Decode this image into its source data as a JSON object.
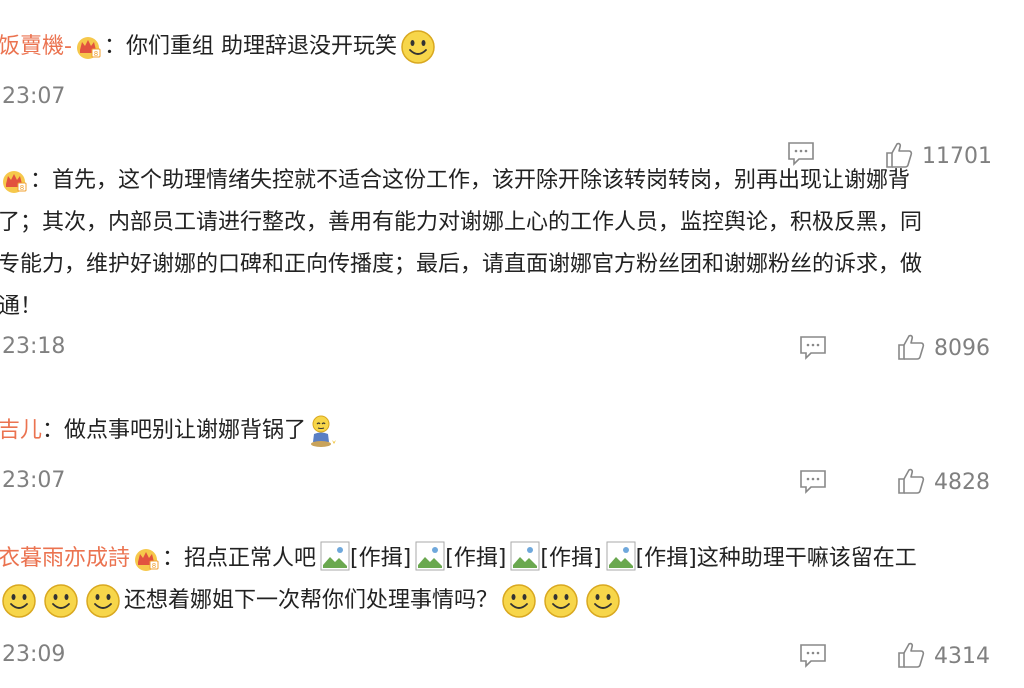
{
  "colors": {
    "username": "#eb7350",
    "meta_text": "#808080",
    "body_text": "#222222",
    "icon_stroke": "#888888"
  },
  "comments": [
    {
      "user": "饭賣機-",
      "colon": "：",
      "text": "你们重组 助理辞退没开玩笑",
      "time": "23:07",
      "likes": "11701",
      "icons": [
        "vip-crown-icon",
        "smiley-emoji"
      ]
    },
    {
      "colon": "：",
      "lines": [
        "首先，这个助理情绪失控就不适合这份工作，该开除开除该转岗转岗，别再出现让谢娜背",
        "了；其次，内部员工请进行整改，善用有能力对谢娜上心的工作人员，监控舆论，积极反黑，同",
        "专能力，维护好谢娜的口碑和正向传播度；最后，请直面谢娜官方粉丝团和谢娜粉丝的诉求，做",
        "通！"
      ],
      "time": "23:18",
      "likes": "8096",
      "icons": [
        "vip-crown-icon"
      ]
    },
    {
      "user": "吉儿",
      "colon": "：",
      "text": "做点事吧别让谢娜背锅了",
      "time": "23:07",
      "likes": "4828",
      "icons": [
        "sitting-emoji"
      ]
    },
    {
      "user": "衣暮雨亦成詩",
      "colon": "：",
      "text_prefix": "招点正常人吧",
      "image_label": "[作揖]",
      "text_suffix": "这种助理干嘛该留在工",
      "line2_text": "还想着娜姐下一次帮你们处理事情吗？",
      "time": "23:09",
      "likes": "4314",
      "icons": [
        "vip-crown-icon",
        "broken-image-icon",
        "smiley-emoji"
      ]
    }
  ]
}
